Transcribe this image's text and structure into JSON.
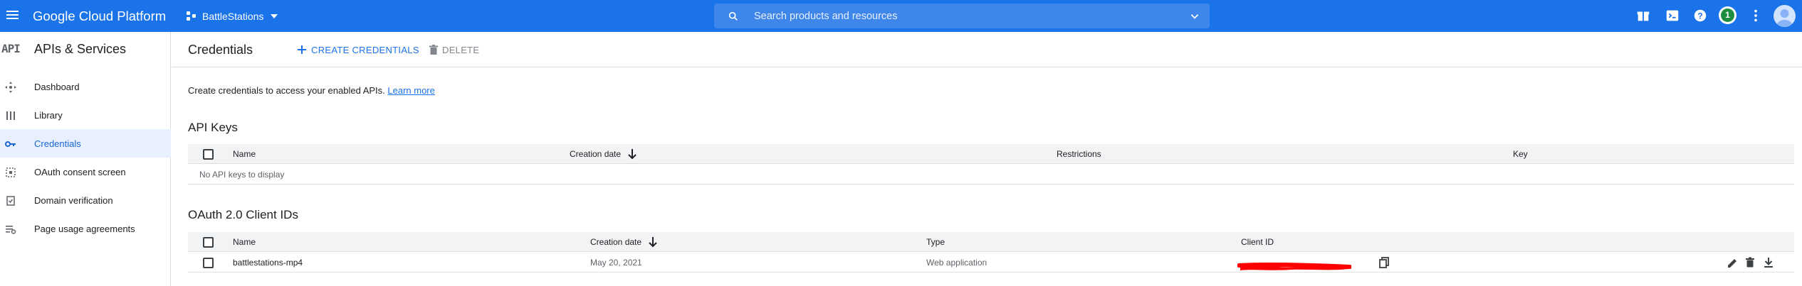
{
  "topbar": {
    "brand": "Google Cloud Platform",
    "project_name": "BattleStations",
    "search_placeholder": "Search products and resources",
    "notification_count": "1",
    "icons": [
      "menu-icon",
      "project-icon",
      "search-icon",
      "chevron-down-icon",
      "gift-icon",
      "cloud-shell-icon",
      "help-icon",
      "more-vert-icon",
      "avatar-icon"
    ]
  },
  "sidebar": {
    "title_icon": "API",
    "title": "APIs & Services",
    "items": [
      {
        "label": "Dashboard",
        "icon": "dashboard-icon",
        "active": false
      },
      {
        "label": "Library",
        "icon": "library-icon",
        "active": false
      },
      {
        "label": "Credentials",
        "icon": "key-icon",
        "active": true
      },
      {
        "label": "OAuth consent screen",
        "icon": "consent-icon",
        "active": false
      },
      {
        "label": "Domain verification",
        "icon": "domain-icon",
        "active": false
      },
      {
        "label": "Page usage agreements",
        "icon": "settings-list-icon",
        "active": false
      }
    ]
  },
  "header": {
    "title": "Credentials",
    "create_label": "CREATE CREDENTIALS",
    "delete_label": "DELETE"
  },
  "intro": {
    "text": "Create credentials to access your enabled APIs.",
    "link": "Learn more"
  },
  "api_keys": {
    "title": "API Keys",
    "columns": [
      "Name",
      "Creation date",
      "Restrictions",
      "Key"
    ],
    "empty_text": "No API keys to display"
  },
  "oauth": {
    "title": "OAuth 2.0 Client IDs",
    "columns": [
      "Name",
      "Creation date",
      "Type",
      "Client ID"
    ],
    "rows": [
      {
        "name": "battlestations-mp4",
        "date": "May 20, 2021",
        "type": "Web application",
        "client_id": ""
      }
    ]
  },
  "colors": {
    "topbar": "#1a73e8",
    "active_nav_bg": "#e8f0fe",
    "accent": "#1a73e8",
    "redaction": "#ff0000",
    "badge": "#1e8e3e"
  }
}
